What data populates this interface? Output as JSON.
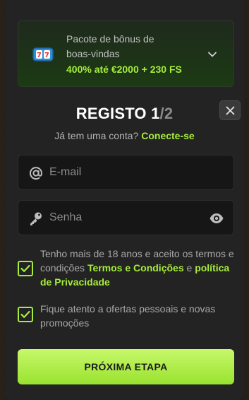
{
  "bonus": {
    "line1": "Pacote de bônus de",
    "line2": "boas-vindas",
    "offer": "400% até €2000 + 230 FS",
    "icon": "slot-machine-icon"
  },
  "header": {
    "title": "REGISTO",
    "step_current": "1",
    "step_separator": "/",
    "step_total": "2"
  },
  "login": {
    "prompt": "Já tem uma conta?",
    "link": "Conecte-se"
  },
  "form": {
    "email_placeholder": "E-mail",
    "password_placeholder": "Senha"
  },
  "terms": {
    "text_a": "Tenho mais de 18 anos e aceito os termos e condições",
    "link_terms": "Termos e Condições",
    "text_and": "e",
    "link_privacy": "política de Privacidade",
    "checked": true
  },
  "offers": {
    "text": "Fique atento a ofertas pessoais e novas promoções",
    "checked": true
  },
  "cta": {
    "label": "PRÓXIMA ETAPA"
  },
  "colors": {
    "accent": "#a5ed3a",
    "background": "#232323",
    "field": "#161616"
  }
}
